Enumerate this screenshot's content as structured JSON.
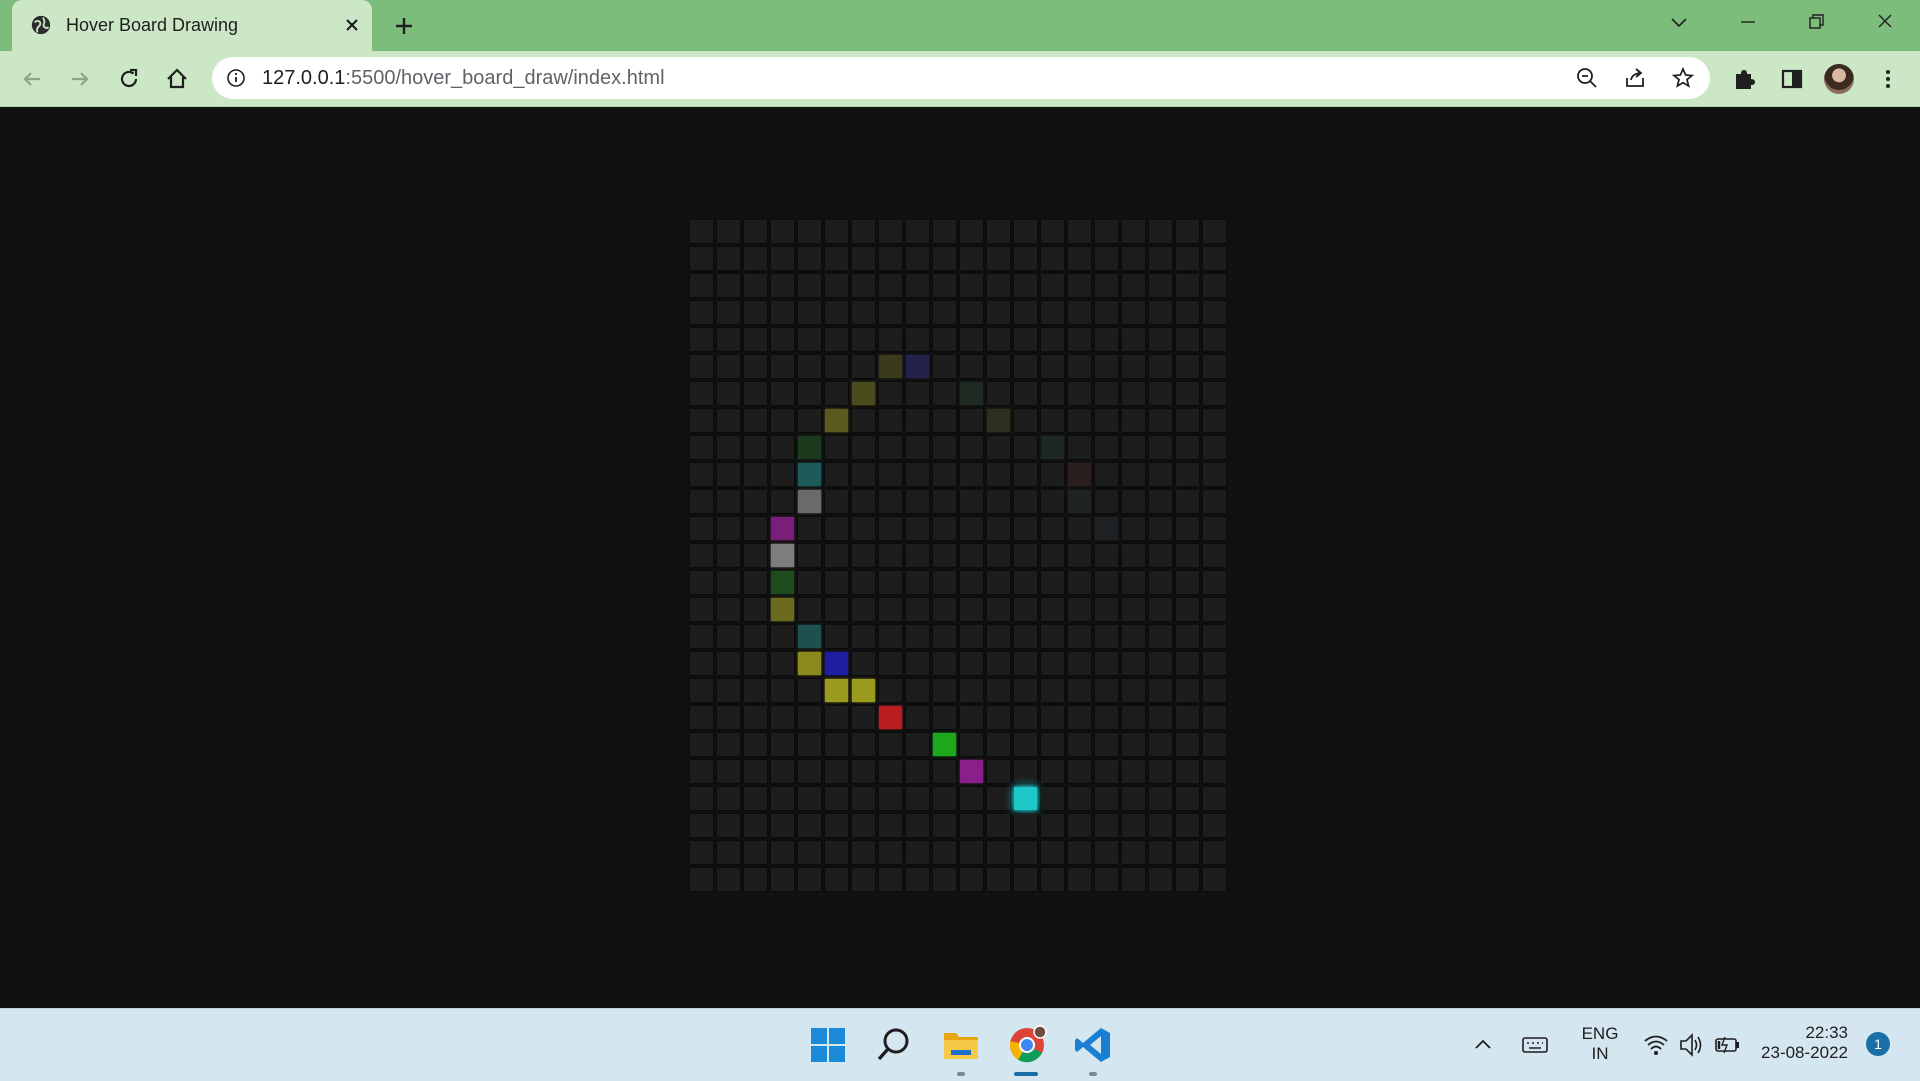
{
  "browser": {
    "tab_title": "Hover Board Drawing",
    "url_host": "127.0.0.1",
    "url_path": ":5500/hover_board_draw/index.html"
  },
  "board": {
    "columns": 20,
    "rows": 25,
    "empty_color": "#1d1d1d",
    "colored_squares": [
      {
        "col": 7,
        "row": 5,
        "color": "#3a3a1e"
      },
      {
        "col": 8,
        "row": 5,
        "color": "#22224a"
      },
      {
        "col": 6,
        "row": 6,
        "color": "#4a4a1e"
      },
      {
        "col": 10,
        "row": 6,
        "color": "#1e2a22"
      },
      {
        "col": 5,
        "row": 7,
        "color": "#5a5a1e"
      },
      {
        "col": 11,
        "row": 7,
        "color": "#2e2e1e"
      },
      {
        "col": 4,
        "row": 8,
        "color": "#1e3a1e"
      },
      {
        "col": 13,
        "row": 8,
        "color": "#1e2626"
      },
      {
        "col": 4,
        "row": 9,
        "color": "#1e5a5a"
      },
      {
        "col": 14,
        "row": 9,
        "color": "#2a1e1e"
      },
      {
        "col": 4,
        "row": 10,
        "color": "#6b6b6b"
      },
      {
        "col": 14,
        "row": 10,
        "color": "#1e2424"
      },
      {
        "col": 3,
        "row": 11,
        "color": "#7a1e7a"
      },
      {
        "col": 15,
        "row": 11,
        "color": "#1e2224"
      },
      {
        "col": 3,
        "row": 12,
        "color": "#7d7d7d"
      },
      {
        "col": 3,
        "row": 13,
        "color": "#1e4a1e"
      },
      {
        "col": 3,
        "row": 14,
        "color": "#6b6b1e"
      },
      {
        "col": 4,
        "row": 15,
        "color": "#1e5050"
      },
      {
        "col": 4,
        "row": 16,
        "color": "#8a8a1e"
      },
      {
        "col": 5,
        "row": 16,
        "color": "#1e1ea0"
      },
      {
        "col": 5,
        "row": 17,
        "color": "#9a9a1e"
      },
      {
        "col": 6,
        "row": 17,
        "color": "#9a9a1e"
      },
      {
        "col": 7,
        "row": 18,
        "color": "#b81e1e"
      },
      {
        "col": 9,
        "row": 19,
        "color": "#1ea81e"
      },
      {
        "col": 10,
        "row": 20,
        "color": "#8a1e8a"
      },
      {
        "col": 12,
        "row": 21,
        "color": "#1ec8c8",
        "glow": true
      }
    ]
  },
  "taskbar": {
    "language_top": "ENG",
    "language_bottom": "IN",
    "time": "22:33",
    "date": "23-08-2022",
    "notification_count": "1"
  },
  "icons": {
    "favicon": "globe-icon",
    "tab_close": "close-icon",
    "new_tab": "plus-icon",
    "zoom": "zoom-out-icon",
    "share": "share-icon",
    "bookmark": "star-icon",
    "extensions": "puzzle-icon",
    "side_panel": "side-panel-icon",
    "menu": "kebab-menu-icon"
  }
}
